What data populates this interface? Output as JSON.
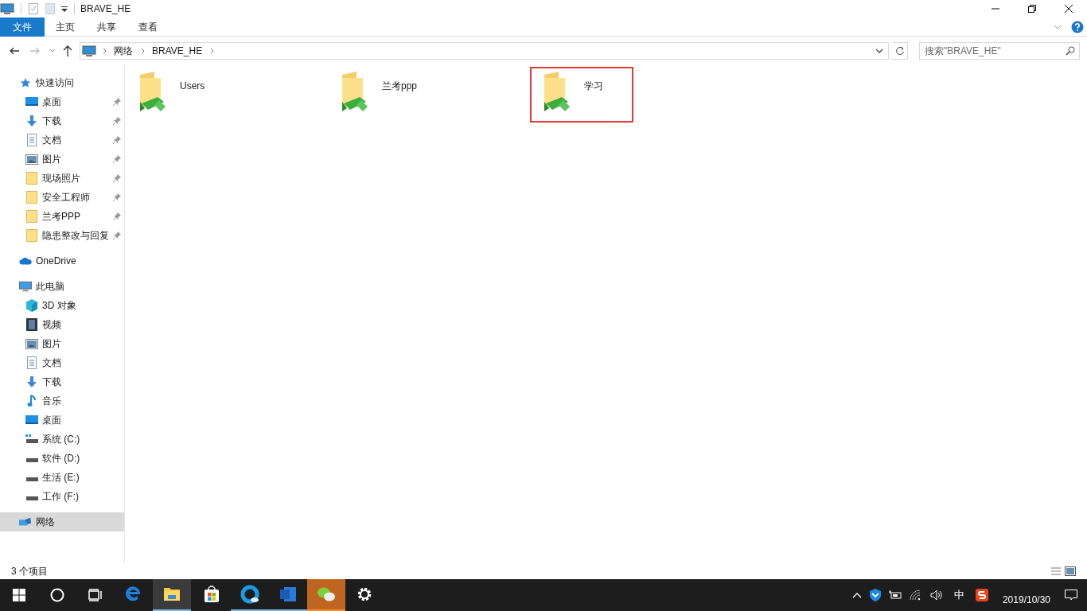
{
  "window": {
    "title": "BRAVE_HE"
  },
  "ribbon_tabs": [
    {
      "label": "文件",
      "selected": true
    },
    {
      "label": "主页",
      "selected": false
    },
    {
      "label": "共享",
      "selected": false
    },
    {
      "label": "查看",
      "selected": false
    }
  ],
  "address": {
    "crumbs": [
      "网络",
      "BRAVE_HE"
    ]
  },
  "search": {
    "placeholder": "搜索\"BRAVE_HE\""
  },
  "sidebar": [
    {
      "label": "快速访问",
      "kind": "star",
      "selected": false,
      "children": [
        {
          "label": "桌面",
          "kind": "desktop",
          "pinned": true,
          "selected": false
        },
        {
          "label": "下载",
          "kind": "download",
          "pinned": true,
          "selected": false
        },
        {
          "label": "文档",
          "kind": "document",
          "pinned": true,
          "selected": false
        },
        {
          "label": "图片",
          "kind": "picture",
          "pinned": true,
          "selected": false
        },
        {
          "label": "现场照片",
          "kind": "folder",
          "pinned": true,
          "selected": false
        },
        {
          "label": "安全工程师",
          "kind": "folder",
          "pinned": true,
          "selected": false
        },
        {
          "label": "兰考PPP",
          "kind": "folder",
          "pinned": true,
          "selected": false
        },
        {
          "label": "隐患整改与回复",
          "kind": "folder",
          "pinned": true,
          "selected": false
        }
      ]
    },
    {
      "label": "OneDrive",
      "kind": "cloud",
      "selected": false
    },
    {
      "label": "此电脑",
      "kind": "pc",
      "selected": false,
      "children": [
        {
          "label": "3D 对象",
          "kind": "cube",
          "pinned": false,
          "selected": false
        },
        {
          "label": "视频",
          "kind": "video",
          "pinned": false,
          "selected": false
        },
        {
          "label": "图片",
          "kind": "picture",
          "pinned": false,
          "selected": false
        },
        {
          "label": "文档",
          "kind": "document",
          "pinned": false,
          "selected": false
        },
        {
          "label": "下载",
          "kind": "download",
          "pinned": false,
          "selected": false
        },
        {
          "label": "音乐",
          "kind": "music",
          "pinned": false,
          "selected": false
        },
        {
          "label": "桌面",
          "kind": "desktop",
          "pinned": false,
          "selected": false
        },
        {
          "label": "系统 (C:)",
          "kind": "system-drive",
          "pinned": false,
          "selected": false
        },
        {
          "label": "软件 (D:)",
          "kind": "drive",
          "pinned": false,
          "selected": false
        },
        {
          "label": "生活 (E:)",
          "kind": "drive",
          "pinned": false,
          "selected": false
        },
        {
          "label": "工作 (F:)",
          "kind": "drive",
          "pinned": false,
          "selected": false
        }
      ]
    },
    {
      "label": "网络",
      "kind": "network",
      "selected": true
    }
  ],
  "files": [
    {
      "name": "Users",
      "highlighted": false
    },
    {
      "name": "兰考ppp",
      "highlighted": false
    },
    {
      "name": "学习",
      "highlighted": true
    }
  ],
  "status_bar": {
    "count": "3 个项目"
  },
  "taskbar": {
    "apps": [
      {
        "kind": "edge",
        "running": false,
        "selected": false,
        "flashing": false
      },
      {
        "kind": "explorer",
        "running": true,
        "selected": true,
        "flashing": false
      },
      {
        "kind": "store",
        "running": false,
        "selected": false,
        "flashing": false
      },
      {
        "kind": "browser",
        "running": true,
        "selected": false,
        "flashing": false
      },
      {
        "kind": "word",
        "running": true,
        "selected": false,
        "flashing": false
      },
      {
        "kind": "chat",
        "running": true,
        "selected": false,
        "flashing": true
      },
      {
        "kind": "settings",
        "running": false,
        "selected": false,
        "flashing": false
      }
    ],
    "tray": {
      "ime": "中",
      "date": "2019/10/30"
    }
  }
}
